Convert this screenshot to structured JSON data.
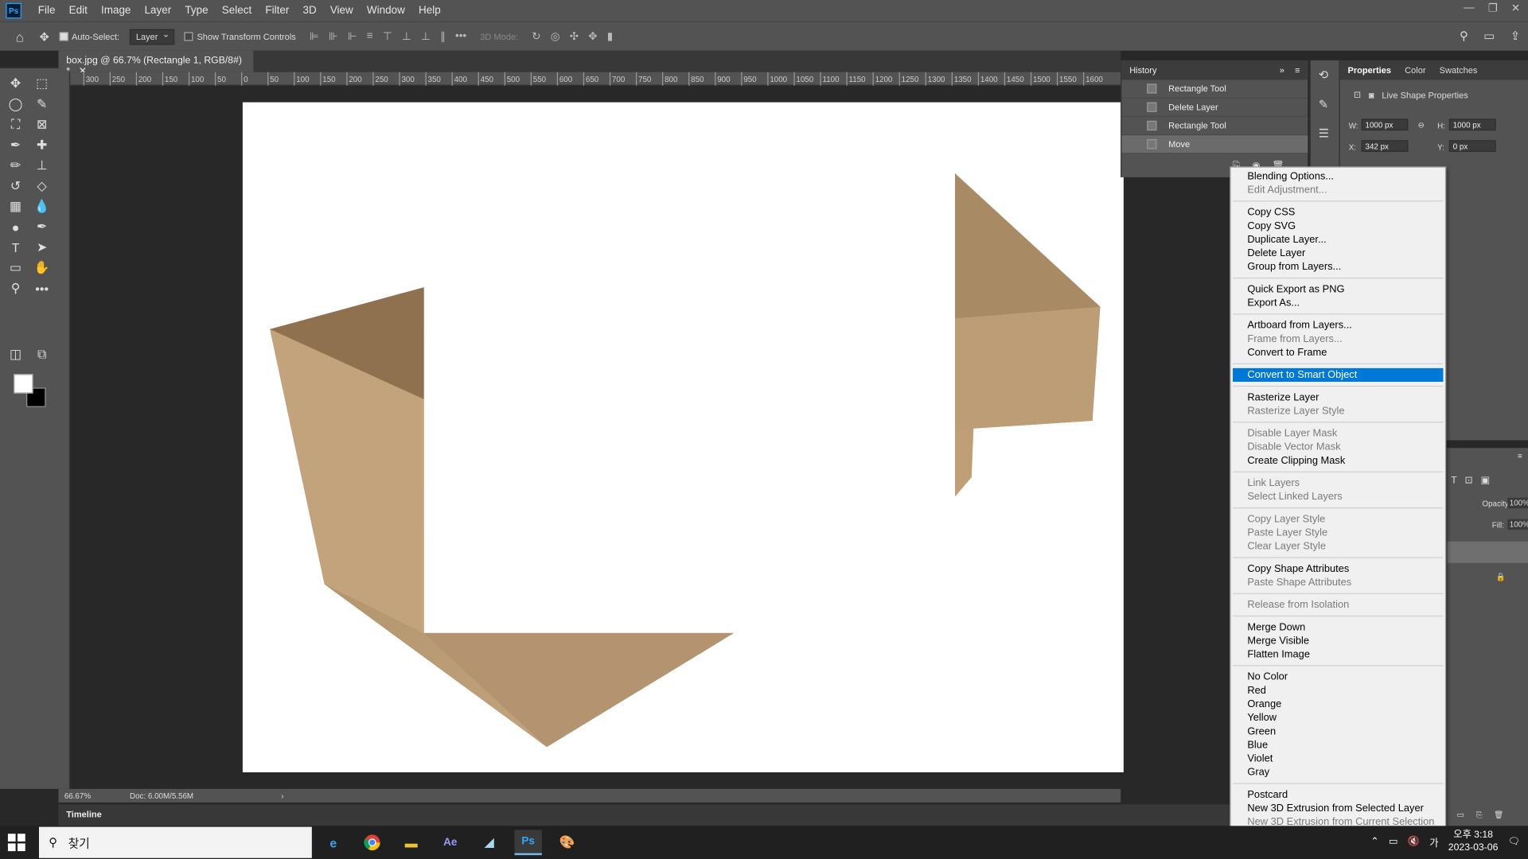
{
  "menubar": {
    "items": [
      "File",
      "Edit",
      "Image",
      "Layer",
      "Type",
      "Select",
      "Filter",
      "3D",
      "View",
      "Window",
      "Help"
    ]
  },
  "options": {
    "auto_select_label": "Auto-Select:",
    "auto_select_value": "Layer",
    "show_transform_label": "Show Transform Controls",
    "mode_3d_label": "3D Mode:"
  },
  "document": {
    "tab_title": "box.jpg @ 66.7% (Rectangle 1, RGB/8#) *",
    "zoom": "66.67%",
    "doc_size": "Doc: 6.00M/5.56M",
    "ruler_ticks": [
      "300",
      "250",
      "200",
      "150",
      "100",
      "50",
      "0",
      "50",
      "100",
      "150",
      "200",
      "250",
      "300",
      "350",
      "400",
      "450",
      "500",
      "550",
      "600",
      "650",
      "700",
      "750",
      "800",
      "850",
      "900",
      "950",
      "1000",
      "1050",
      "1100",
      "1150",
      "1200",
      "1250",
      "1300",
      "1350",
      "1400",
      "1450",
      "1500",
      "1550",
      "1600"
    ]
  },
  "timeline": {
    "label": "Timeline"
  },
  "history": {
    "title": "History",
    "items": [
      {
        "label": "Rectangle Tool"
      },
      {
        "label": "Delete Layer"
      },
      {
        "label": "Rectangle Tool"
      },
      {
        "label": "Move"
      }
    ]
  },
  "properties": {
    "tabs": [
      "Properties",
      "Color",
      "Swatches"
    ],
    "subtitle": "Live Shape Properties",
    "w_label": "W:",
    "w_value": "1000 px",
    "h_label": "H:",
    "h_value": "1000 px",
    "x_label": "X:",
    "x_value": "342 px",
    "y_label": "Y:",
    "y_value": "0 px"
  },
  "layers": {
    "opacity_label": "Opacity:",
    "opacity_value": "100%",
    "fill_label": "Fill:",
    "fill_value": "100%"
  },
  "context_menu": {
    "groups": [
      [
        {
          "label": "Blending Options...",
          "enabled": true
        },
        {
          "label": "Edit Adjustment...",
          "enabled": false
        }
      ],
      [
        {
          "label": "Copy CSS",
          "enabled": true
        },
        {
          "label": "Copy SVG",
          "enabled": true
        },
        {
          "label": "Duplicate Layer...",
          "enabled": true
        },
        {
          "label": "Delete Layer",
          "enabled": true
        },
        {
          "label": "Group from Layers...",
          "enabled": true
        }
      ],
      [
        {
          "label": "Quick Export as PNG",
          "enabled": true
        },
        {
          "label": "Export As...",
          "enabled": true
        }
      ],
      [
        {
          "label": "Artboard from Layers...",
          "enabled": true
        },
        {
          "label": "Frame from Layers...",
          "enabled": false
        },
        {
          "label": "Convert to Frame",
          "enabled": true
        }
      ],
      [
        {
          "label": "Convert to Smart Object",
          "enabled": true,
          "highlighted": true
        }
      ],
      [
        {
          "label": "Rasterize Layer",
          "enabled": true
        },
        {
          "label": "Rasterize Layer Style",
          "enabled": false
        }
      ],
      [
        {
          "label": "Disable Layer Mask",
          "enabled": false
        },
        {
          "label": "Disable Vector Mask",
          "enabled": false
        },
        {
          "label": "Create Clipping Mask",
          "enabled": true
        }
      ],
      [
        {
          "label": "Link Layers",
          "enabled": false
        },
        {
          "label": "Select Linked Layers",
          "enabled": false
        }
      ],
      [
        {
          "label": "Copy Layer Style",
          "enabled": false
        },
        {
          "label": "Paste Layer Style",
          "enabled": false
        },
        {
          "label": "Clear Layer Style",
          "enabled": false
        }
      ],
      [
        {
          "label": "Copy Shape Attributes",
          "enabled": true
        },
        {
          "label": "Paste Shape Attributes",
          "enabled": false
        }
      ],
      [
        {
          "label": "Release from Isolation",
          "enabled": false
        }
      ],
      [
        {
          "label": "Merge Down",
          "enabled": true
        },
        {
          "label": "Merge Visible",
          "enabled": true
        },
        {
          "label": "Flatten Image",
          "enabled": true
        }
      ],
      [
        {
          "label": "No Color",
          "enabled": true
        },
        {
          "label": "Red",
          "enabled": true
        },
        {
          "label": "Orange",
          "enabled": true
        },
        {
          "label": "Yellow",
          "enabled": true
        },
        {
          "label": "Green",
          "enabled": true
        },
        {
          "label": "Blue",
          "enabled": true
        },
        {
          "label": "Violet",
          "enabled": true
        },
        {
          "label": "Gray",
          "enabled": true
        }
      ],
      [
        {
          "label": "Postcard",
          "enabled": true
        },
        {
          "label": "New 3D Extrusion from Selected Layer",
          "enabled": true
        },
        {
          "label": "New 3D Extrusion from Current Selection",
          "enabled": false
        }
      ]
    ]
  },
  "taskbar": {
    "search_placeholder": "찾기",
    "apps": [
      "IE",
      "Chrome",
      "Explorer",
      "Ae",
      "Notes",
      "Ps",
      "Paint"
    ],
    "time": "오후 3:18",
    "date": "2023-03-06",
    "ime": "가"
  },
  "colors": {
    "highlight": "#0078d7",
    "ps_blue": "#31a8ff",
    "cardboard": "#b89a72"
  }
}
